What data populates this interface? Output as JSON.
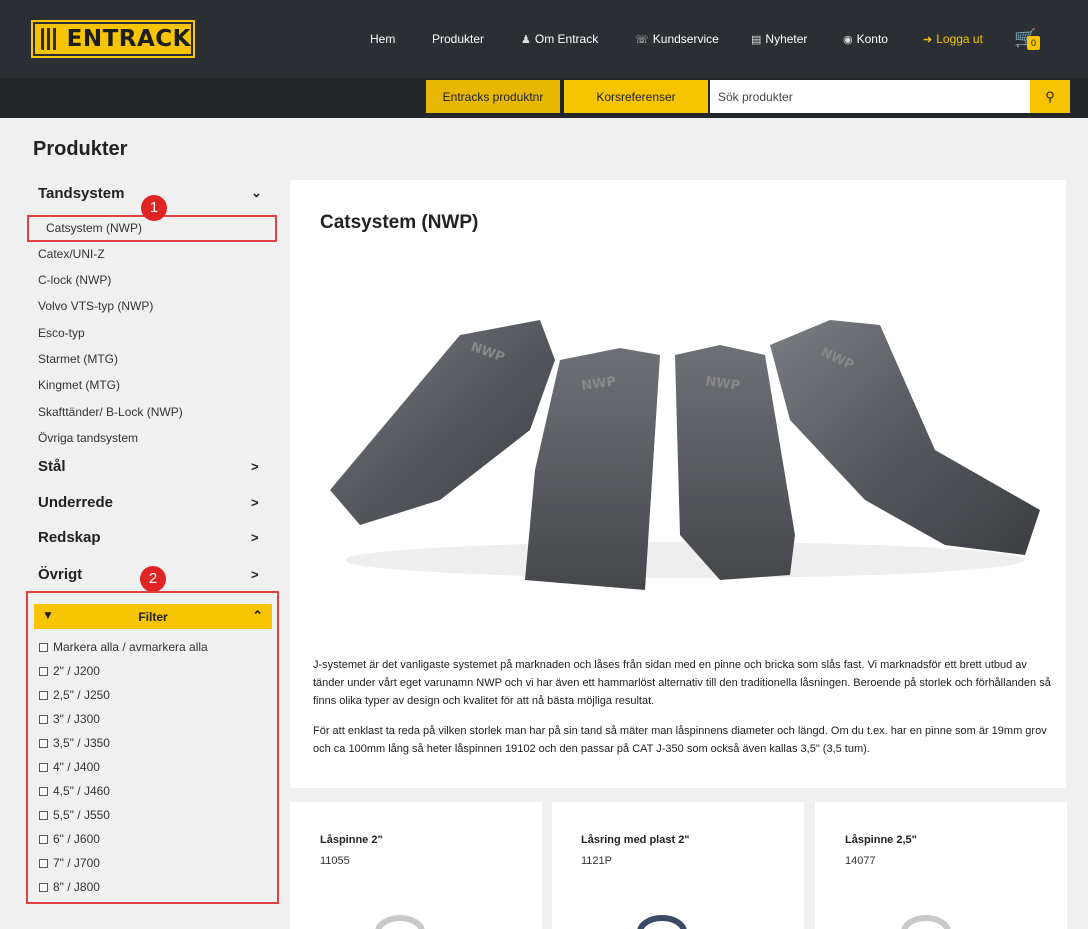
{
  "brand": {
    "logo_text": "ENTRACK"
  },
  "nav": {
    "home": "Hem",
    "products": "Produkter",
    "about": "Om Entrack",
    "support": "Kundservice",
    "news": "Nyheter",
    "account": "Konto",
    "logout": "Logga ut",
    "cart_count": "0"
  },
  "search": {
    "tab_own": "Entracks produktnr",
    "tab_cross": "Korsreferenser",
    "placeholder": "Sök produkter"
  },
  "sidebar": {
    "title": "Produkter",
    "categories": [
      {
        "label": "Tandsystem"
      },
      {
        "label": "Stål"
      },
      {
        "label": "Underrede"
      },
      {
        "label": "Redskap"
      },
      {
        "label": "Övrigt"
      }
    ],
    "subitems": [
      "Catsystem (NWP)",
      "Catex/UNI-Z",
      "C-lock (NWP)",
      "Volvo VTS-typ (NWP)",
      "Esco-typ",
      "Starmet (MTG)",
      "Kingmet (MTG)",
      "Skafttänder/ B-Lock (NWP)",
      "Övriga tandsystem"
    ]
  },
  "filter": {
    "title": "Filter",
    "options": [
      "Markera alla / avmarkera alla",
      "2\" / J200",
      "2,5\" / J250",
      "3\" / J300",
      "3,5\" / J350",
      "4\" / J400",
      "4,5\" / J460",
      "5,5\" / J550",
      "6\" / J600",
      "7\" / J700",
      "8\" / J800"
    ]
  },
  "annotations": {
    "marker1": "1",
    "marker2": "2"
  },
  "main": {
    "title": "Catsystem (NWP)",
    "paragraph1": "J-systemet är det vanligaste systemet på marknaden och låses från sidan med en pinne och bricka som slås fast. Vi marknadsför ett brett utbud av tänder under vårt eget varunamn NWP och vi har även ett hammarlöst alternativ till den traditionella låsningen. Beroende på storlek och förhållanden så finns olika typer av design och kvalitet för att nå bästa möjliga resultat.",
    "paragraph2": "För att enklast ta reda på vilken storlek man har på sin tand så mäter man låspinnens diameter och längd. Om du t.ex. har en pinne som är 19mm grov och ca 100mm lång så heter låspinnen 19102 och den passar på CAT J-350 som också även kallas 3,5\" (3,5 tum).",
    "hero_text": [
      "NWP",
      "NWP",
      "NWP",
      "NWP"
    ]
  },
  "products": [
    {
      "name": "Låspinne 2\"",
      "number": "11055"
    },
    {
      "name": "Låsring med plast 2\"",
      "number": "1121P"
    },
    {
      "name": "Låspinne 2,5\"",
      "number": "14077"
    }
  ],
  "colors": {
    "accent": "#f6c400",
    "nav_bg": "#2b2f33",
    "annotation": "#e02424"
  }
}
